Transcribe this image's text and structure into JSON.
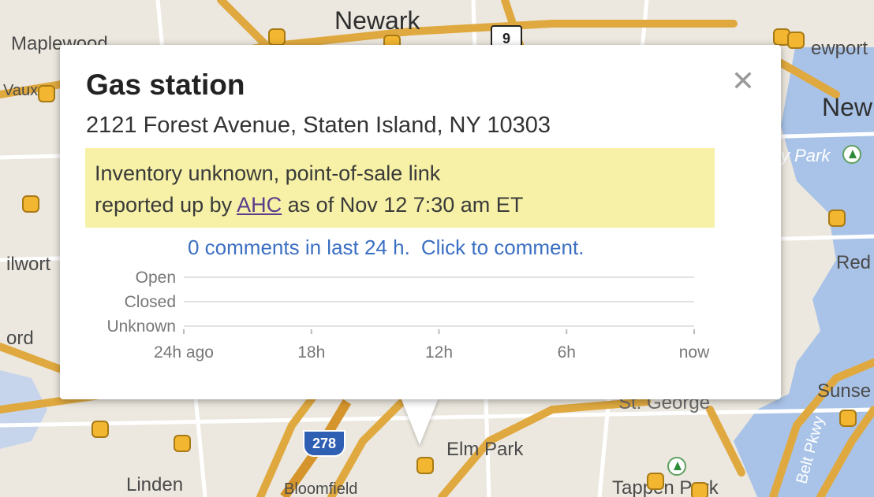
{
  "map": {
    "places": [
      {
        "id": "newark",
        "label": "Newark",
        "size": "big"
      },
      {
        "id": "maplewood",
        "label": "Maplewood",
        "size": "med"
      },
      {
        "id": "newport",
        "label": "ewport",
        "size": "med"
      },
      {
        "id": "new",
        "label": "New",
        "size": "big"
      },
      {
        "id": "park",
        "label": "y Park",
        "size": "park"
      },
      {
        "id": "red",
        "label": "Red",
        "size": "med"
      },
      {
        "id": "ilwort",
        "label": "ilwort",
        "size": "med"
      },
      {
        "id": "ord",
        "label": "ord",
        "size": "med"
      },
      {
        "id": "sunset",
        "label": "Sunse",
        "size": "med"
      },
      {
        "id": "stgeorge",
        "label": "St. George",
        "size": "med"
      },
      {
        "id": "elmpark",
        "label": "Elm Park",
        "size": "med"
      },
      {
        "id": "linden",
        "label": "Linden",
        "size": "med"
      },
      {
        "id": "bloomfield",
        "label": "Bloomfield",
        "size": "sm"
      },
      {
        "id": "tappenpark",
        "label": "Tappen Park",
        "size": "med"
      },
      {
        "id": "beltpkwy",
        "label": "Belt Pkwy",
        "size": "sm"
      },
      {
        "id": "vaux",
        "label": "Vaux",
        "size": "sm"
      }
    ],
    "shields": {
      "route9": "9",
      "route278": "278"
    }
  },
  "info_window": {
    "title": "Gas station",
    "close_symbol": "✕",
    "address": "2121 Forest Avenue, Staten Island, NY 10303",
    "status_line1": "Inventory unknown, point-of-sale link",
    "status_line2_prefix": "reported up by ",
    "status_link": "AHC",
    "status_line2_suffix": " as of Nov 12 7:30 am ET",
    "comments_count": "0 comments in last 24 h.",
    "comments_cta": "Click to comment."
  },
  "chart_data": {
    "type": "line",
    "categories": [
      "Open",
      "Closed",
      "Unknown"
    ],
    "x": [
      "24h ago",
      "18h",
      "12h",
      "6h",
      "now"
    ],
    "series": [],
    "colors": {
      "gridline": "#e2e2e2",
      "label": "#777777"
    }
  },
  "colors": {
    "map_land": "#ece8df",
    "water": "#a9c3e8",
    "road": "#e0a93f",
    "poi": "#f2b630",
    "status_bg": "#f6f1a6",
    "link": "#3b6fc2"
  }
}
